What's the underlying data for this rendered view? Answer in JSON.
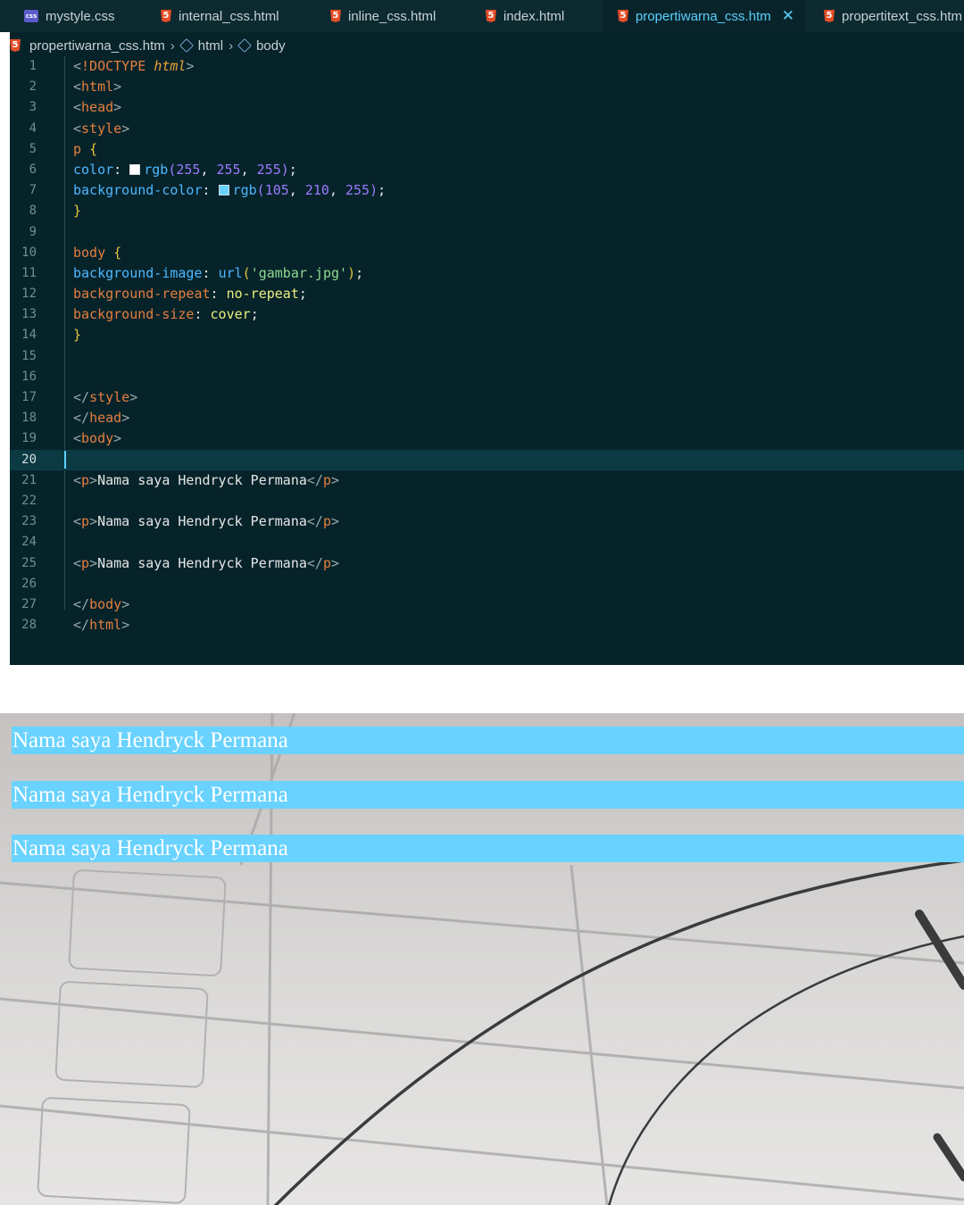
{
  "tabs": [
    {
      "label": "mystyle.css",
      "icon": "css-file-icon",
      "active": false
    },
    {
      "label": "internal_css.html",
      "icon": "html5-file-icon",
      "active": false
    },
    {
      "label": "inline_css.html",
      "icon": "html5-file-icon",
      "active": false
    },
    {
      "label": "index.html",
      "icon": "html5-file-icon",
      "active": false
    },
    {
      "label": "propertiwarna_css.htm",
      "icon": "html5-file-icon",
      "active": true
    },
    {
      "label": "propertitext_css.htm",
      "icon": "html5-file-icon",
      "active": false
    }
  ],
  "breadcrumb": {
    "file": "propertiwarna_css.htm",
    "items": [
      "html",
      "body"
    ]
  },
  "editor": {
    "current_line": 20,
    "lines": [
      {
        "num": "1",
        "text": "<!DOCTYPE html>"
      },
      {
        "num": "2",
        "text": "<html>"
      },
      {
        "num": "3",
        "text": "<head>"
      },
      {
        "num": "4",
        "text": "<style>"
      },
      {
        "num": "5",
        "text": "p {"
      },
      {
        "num": "6",
        "text": "color: rgb(255, 255, 255);"
      },
      {
        "num": "7",
        "text": "background-color: rgb(105, 210, 255);"
      },
      {
        "num": "8",
        "text": "}"
      },
      {
        "num": "9",
        "text": ""
      },
      {
        "num": "10",
        "text": "body {"
      },
      {
        "num": "11",
        "text": "background-image: url('gambar.jpg');"
      },
      {
        "num": "12",
        "text": "background-repeat: no-repeat;"
      },
      {
        "num": "13",
        "text": "background-size: cover;"
      },
      {
        "num": "14",
        "text": "}"
      },
      {
        "num": "15",
        "text": ""
      },
      {
        "num": "16",
        "text": ""
      },
      {
        "num": "17",
        "text": "</style>"
      },
      {
        "num": "18",
        "text": "</head>"
      },
      {
        "num": "19",
        "text": "<body>"
      },
      {
        "num": "20",
        "text": ""
      },
      {
        "num": "21",
        "text": "<p>Nama saya Hendryck Permana</p>"
      },
      {
        "num": "22",
        "text": ""
      },
      {
        "num": "23",
        "text": "<p>Nama saya Hendryck Permana</p>"
      },
      {
        "num": "24",
        "text": ""
      },
      {
        "num": "25",
        "text": "<p>Nama saya Hendryck Permana</p>"
      },
      {
        "num": "26",
        "text": ""
      },
      {
        "num": "27",
        "text": "</body>"
      },
      {
        "num": "28",
        "text": "</html>"
      }
    ],
    "swatches": {
      "line6": "#ffffff",
      "line7": "#69d2ff"
    }
  },
  "preview": {
    "paragraphs": [
      "Nama saya Hendryck Permana",
      "Nama saya Hendryck Permana",
      "Nama saya Hendryck Permana"
    ],
    "paragraph_bg": "#69d2ff",
    "paragraph_color": "#ffffff"
  }
}
